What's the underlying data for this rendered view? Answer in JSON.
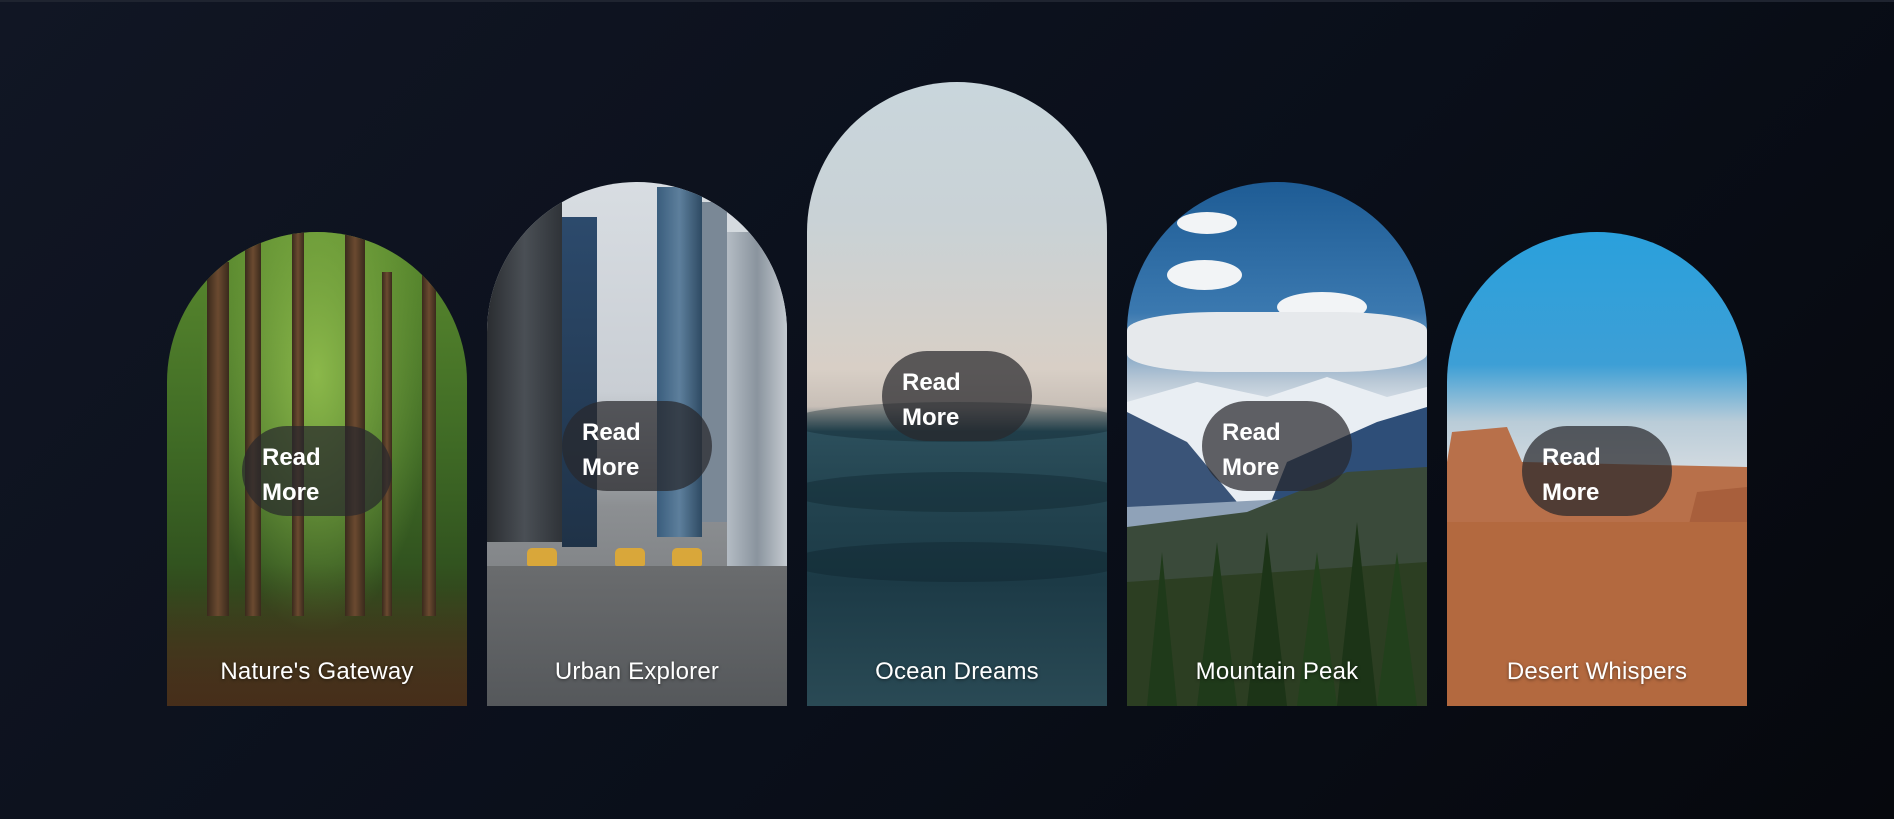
{
  "cards": [
    {
      "title": "Nature's Gateway",
      "button": {
        "line1": "Read",
        "line2": "More"
      },
      "image": "forest-path"
    },
    {
      "title": "Urban Explorer",
      "button": {
        "line1": "Read",
        "line2": "More"
      },
      "image": "city-street"
    },
    {
      "title": "Ocean Dreams",
      "button": {
        "line1": "Read",
        "line2": "More"
      },
      "image": "ocean-waves"
    },
    {
      "title": "Mountain Peak",
      "button": {
        "line1": "Read",
        "line2": "More"
      },
      "image": "mountain-valley"
    },
    {
      "title": "Desert Whispers",
      "button": {
        "line1": "Read",
        "line2": "More"
      },
      "image": "desert-mesa"
    }
  ],
  "colors": {
    "background": "#0a0f1a",
    "button_bg": "#28282c",
    "text": "#ffffff"
  }
}
